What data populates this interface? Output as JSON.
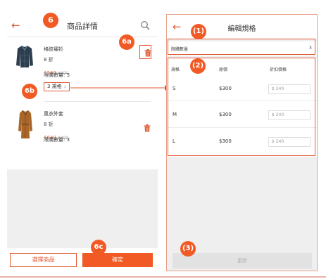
{
  "left": {
    "title": "商品詳情",
    "back_icon": "arrow-left",
    "search_icon": "magnifier",
    "products": [
      {
        "name": "格紋襯衫",
        "discount": "8 折",
        "price_now": "$240",
        "price_old": "$300",
        "limit": "限購數量: 3",
        "spec": "3 規格",
        "spec_icon": "chevron-right",
        "delete_icon": "trash"
      },
      {
        "name": "風衣外套",
        "discount": "8 折",
        "price_now": "$640",
        "price_old": "$800",
        "limit": "限購數量: 3",
        "delete_icon": "trash"
      }
    ],
    "choose_label": "選擇商品",
    "confirm_label": "確定"
  },
  "right": {
    "title": "編輯規格",
    "back_icon": "arrow-left",
    "limit_label": "限購數量",
    "limit_value": "3",
    "columns": [
      "規格",
      "原價",
      "折扣價格"
    ],
    "rows": [
      {
        "spec": "S",
        "price": "$300",
        "discount_price": "$ 240"
      },
      {
        "spec": "M",
        "price": "$300",
        "discount_price": "$ 240"
      },
      {
        "spec": "L",
        "price": "$300",
        "discount_price": "$ 240"
      }
    ],
    "update_label": "更新"
  },
  "annotations": {
    "b6": "6",
    "b6a": "6a",
    "b6b": "6b",
    "b6c": "6c",
    "b1": "(1)",
    "b2": "(2)",
    "b3": "(3)"
  },
  "colors": {
    "accent": "#f15a24",
    "accent_text": "#e05a33",
    "disabled": "#e2e2e2",
    "screen_bg": "#efefef"
  }
}
